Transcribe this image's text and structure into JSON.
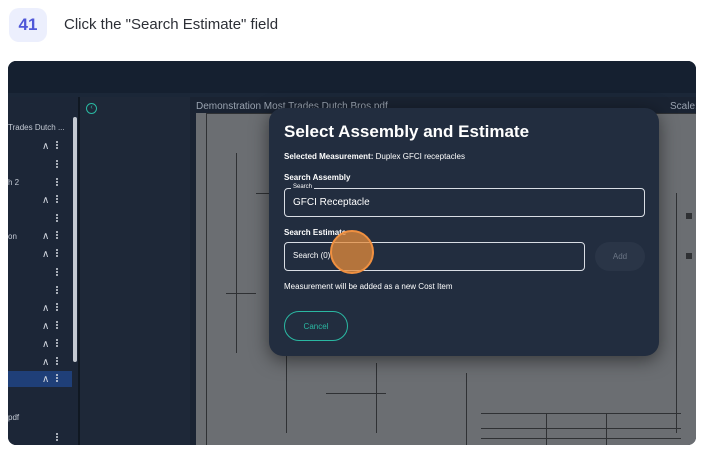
{
  "step": {
    "number": "41",
    "instruction": "Click the \"Search Estimate\" field"
  },
  "sidebar": {
    "labels": [
      {
        "text": "Trades Dutch ...",
        "row": 0
      },
      {
        "text": "h 2",
        "row": 3
      },
      {
        "text": "on",
        "row": 7
      },
      {
        "text": "pdf",
        "row": 15
      }
    ]
  },
  "document": {
    "title": "Demonstration Most Trades Dutch Bros.pdf",
    "scale_label": "Scale:"
  },
  "modal": {
    "title": "Select Assembly and Estimate",
    "selected_measurement_label": "Selected Measurement:",
    "selected_measurement_value": "Duplex GFCI receptacles",
    "search_assembly_label": "Search Assembly",
    "search_assembly_legend": "Search",
    "search_assembly_value": "GFCI Receptacle",
    "search_estimate_label": "Search Estimate",
    "search_estimate_value": "Search (0)",
    "add_button": "Add",
    "info_text": "Measurement will be added as a new Cost Item",
    "cancel_button": "Cancel"
  },
  "colors": {
    "accent": "#2ab8a2",
    "modal_bg": "#222d3f",
    "click_highlight": "#f09040",
    "badge_text": "#4f57d8"
  }
}
